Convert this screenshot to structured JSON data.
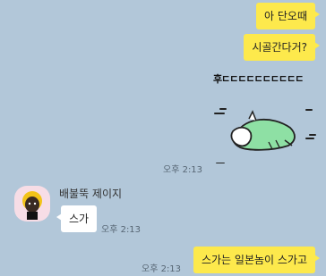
{
  "messages": [
    {
      "text": "아 단오때",
      "side": "me"
    },
    {
      "text": "시골간다거?",
      "side": "me"
    },
    {
      "text": "후ㄷㄷㄷㄷㄷㄷㄷㄷㄷㄷ",
      "side": "me",
      "type": "emoticon-caption"
    },
    {
      "text": "스가",
      "side": "you"
    },
    {
      "text": "스가는 일본놈이 스가고",
      "side": "me"
    }
  ],
  "times": {
    "emoticon_time": "오후 2:13",
    "other_time": "오후 2:13",
    "last_time": "오후 2:13"
  },
  "sender": {
    "name": "배불뚝 제이지"
  },
  "colors": {
    "background": "#b2c7d9",
    "my_bubble": "#fde94c",
    "their_bubble": "#ffffff",
    "emoticon_body": "#8ee0a4"
  },
  "icons": {
    "avatar": "character-avatar-icon",
    "emoticon": "sleeping-character-emoticon"
  }
}
